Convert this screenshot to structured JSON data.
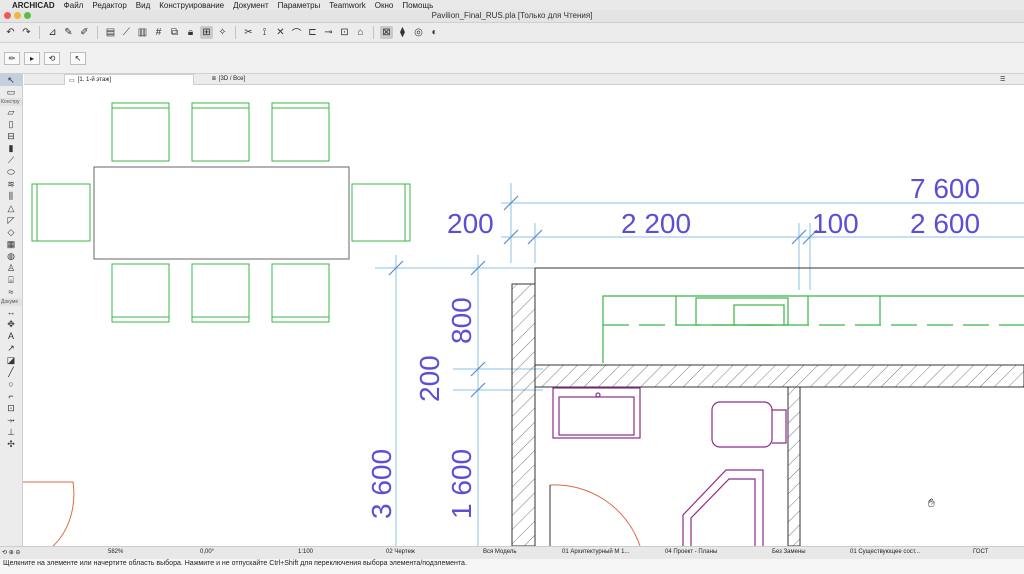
{
  "menu": {
    "apple": "",
    "app": "ARCHICAD",
    "items": [
      "Файл",
      "Редактор",
      "Вид",
      "Конструирование",
      "Документ",
      "Параметры",
      "Teamwork",
      "Окно",
      "Помощь"
    ]
  },
  "window": {
    "title": "Pavilion_Final_RUS.pla [Только для Чтения]"
  },
  "toolbox": {
    "design_header": "Констру",
    "document_header": "Докуме"
  },
  "tabs": {
    "floor": "[1. 1-й этаж]",
    "view3d": "[3D / Все]"
  },
  "dimensions": {
    "total": "7 600",
    "top_a": "200",
    "top_b": "2 200",
    "top_c": "100",
    "top_d": "2 600",
    "left_a": "800",
    "left_b": "200",
    "left_c": "1 600",
    "left_d": "3 600"
  },
  "status": {
    "zoom": "582%",
    "angle": "0,00°",
    "scale": "1:100",
    "drawing": "02 Чертеж",
    "model": "Вся Модель",
    "arch": "01 Архитектурный М 1...",
    "plans": "04 Проект - Планы",
    "override": "Без Замены",
    "existing": "01 Существующее сост...",
    "standard": "ГОСТ"
  },
  "hint": "Щелкните на элементе или начертите область выбора. Нажмите и не отпускайте Ctrl+Shift для переключения выбора элемента/подэлемента.",
  "colors": {
    "furniture": "#3bb54a",
    "dimension": "#5b4fd6",
    "fixture": "#8e2c8c",
    "door_arc": "#e0694a"
  }
}
